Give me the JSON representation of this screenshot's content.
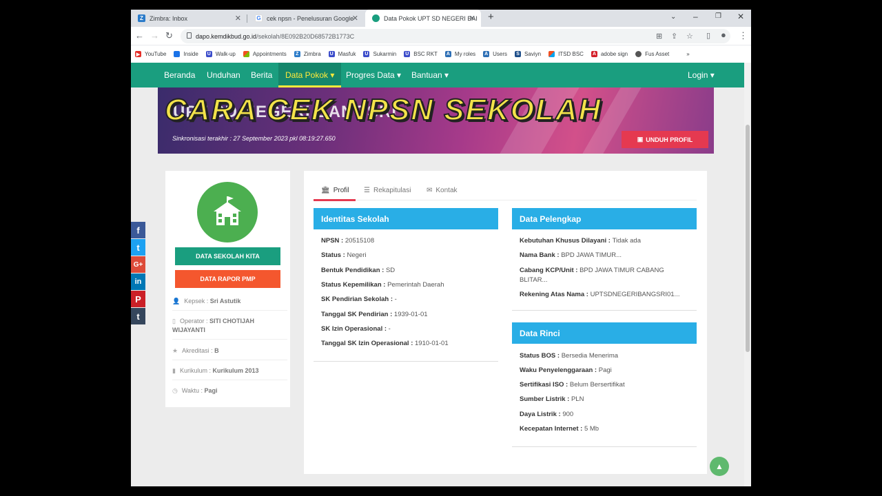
{
  "browser": {
    "tabs": [
      {
        "title": "Zimbra: Inbox",
        "icon": "zimbra-icon"
      },
      {
        "title": "cek npsn - Penelusuran Google",
        "icon": "google-icon"
      },
      {
        "title": "Data Pokok UPT SD NEGERI BAI",
        "icon": "dapo-icon"
      }
    ],
    "new_tab": "+",
    "url_host": "dapo.kemdikbud.go.id",
    "url_path": "/sekolah/8E092B20D68572B1773C"
  },
  "bookmarks": [
    "YouTube",
    "Inside",
    "Walk-up",
    "Appointments",
    "Zimbra",
    "Masfuk",
    "Sukarmin",
    "BSC RKT",
    "My roles",
    "Users",
    "Saviyn",
    "ITSD BSC",
    "adobe sign",
    "Fus Asset"
  ],
  "nav": {
    "items": [
      "Beranda",
      "Unduhan",
      "Berita",
      "Data Pokok ▾",
      "Progres Data ▾",
      "Bantuan ▾"
    ],
    "login": "Login ▾"
  },
  "banner": {
    "school_name": "UPT SD NEGERI BANGSRI",
    "overlay_text": "CARA CEK NPSN SEKOLAH",
    "sync_text": "Sinkronisasi terakhir : 27 September 2023 pkl 08:19:27.650",
    "download_button": "UNDUH PROFIL"
  },
  "left": {
    "btn_data_sekolah": "DATA SEKOLAH KITA",
    "btn_rapor": "DATA RAPOR PMP",
    "kepsek_label": "Kepsek : ",
    "kepsek": "Sri Astutik",
    "operator_label": "Operator : ",
    "operator": "SITI CHOTIJAH WIJAYANTI",
    "akreditasi_label": "Akreditasi : ",
    "akreditasi": "B",
    "kurikulum_label": "Kurikulum : ",
    "kurikulum": "Kurikulum 2013",
    "waktu_label": "Waktu : ",
    "waktu": "Pagi"
  },
  "social": [
    "f",
    "t",
    "G+",
    "in",
    "P",
    "t"
  ],
  "tabs": [
    "Profil",
    "Rekapitulasi",
    "Kontak"
  ],
  "identitas": {
    "title": "Identitas Sekolah",
    "rows": [
      {
        "k": "NPSN : ",
        "v": "20515108"
      },
      {
        "k": "Status : ",
        "v": "Negeri"
      },
      {
        "k": "Bentuk Pendidikan : ",
        "v": "SD"
      },
      {
        "k": "Status Kepemilikan : ",
        "v": "Pemerintah Daerah"
      },
      {
        "k": "SK Pendirian Sekolah : ",
        "v": "-"
      },
      {
        "k": "Tanggal SK Pendirian : ",
        "v": "1939-01-01"
      },
      {
        "k": "SK Izin Operasional : ",
        "v": "-"
      },
      {
        "k": "Tanggal SK Izin Operasional : ",
        "v": "1910-01-01"
      }
    ]
  },
  "pelengkap": {
    "title": "Data Pelengkap",
    "rows": [
      {
        "k": "Kebutuhan Khusus Dilayani : ",
        "v": "Tidak ada"
      },
      {
        "k": "Nama Bank : ",
        "v": "BPD JAWA TIMUR..."
      },
      {
        "k": "Cabang KCP/Unit : ",
        "v": "BPD JAWA TIMUR CABANG BLITAR..."
      },
      {
        "k": "Rekening Atas Nama : ",
        "v": "UPTSDNEGERIBANGSRI01..."
      }
    ]
  },
  "rinci": {
    "title": "Data Rinci",
    "rows": [
      {
        "k": "Status BOS : ",
        "v": "Bersedia Menerima"
      },
      {
        "k": "Waku Penyelenggaraan : ",
        "v": "Pagi"
      },
      {
        "k": "Sertifikasi ISO : ",
        "v": "Belum Bersertifikat"
      },
      {
        "k": "Sumber Listrik : ",
        "v": "PLN"
      },
      {
        "k": "Daya Listrik : ",
        "v": "900"
      },
      {
        "k": "Kecepatan Internet : ",
        "v": "5 Mb"
      }
    ]
  },
  "colors": {
    "nav": "#1a9e7f",
    "panel_header": "#29aee6",
    "accent_red": "#e53950",
    "school_icon": "#4caf50"
  }
}
